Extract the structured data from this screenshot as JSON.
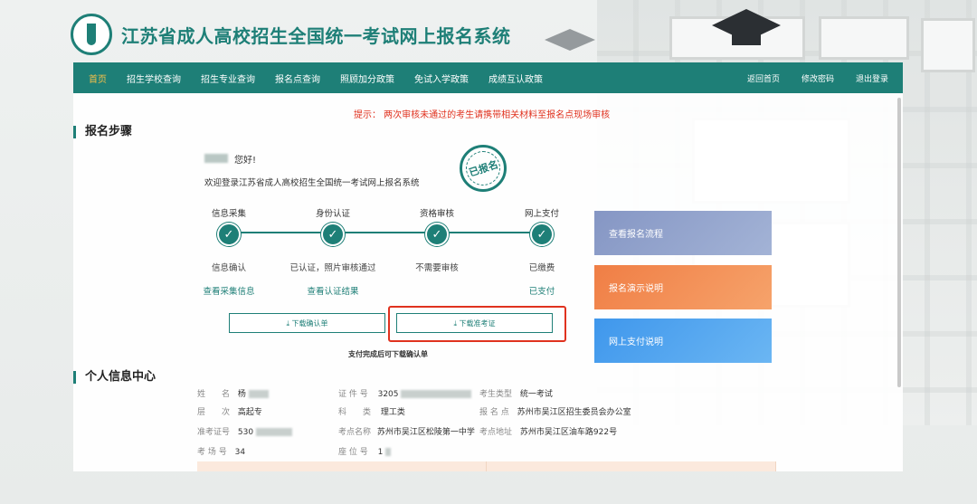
{
  "header": {
    "title": "江苏省成人高校招生全国统一考试网上报名系统"
  },
  "nav": {
    "items": [
      "首页",
      "招生学校查询",
      "招生专业查询",
      "报名点查询",
      "照顾加分政策",
      "免试入学政策",
      "成绩互认政策"
    ],
    "right_items": [
      "返回首页",
      "修改密码",
      "退出登录"
    ]
  },
  "hint": "提示：  两次审核未通过的考生请携带相关材料至报名点现场审核",
  "steps_section": {
    "title": "报名步骤",
    "greeting": "您好!",
    "welcome": "欢迎登录江苏省成人高校招生全国统一考试网上报名系统",
    "stamp": "已报名",
    "steps": [
      {
        "label": "信息采集",
        "status": "信息确认",
        "link": "查看采集信息"
      },
      {
        "label": "身份认证",
        "status": "已认证，照片审核通过",
        "link": "查看认证结果"
      },
      {
        "label": "资格审核",
        "status": "不需要审核",
        "link": ""
      },
      {
        "label": "网上支付",
        "status": "已缴费",
        "link": "已支付"
      }
    ],
    "download_confirm": "⤓ 下载确认单",
    "download_admission": "⤓ 下载准考证",
    "pay_note": "支付完成后可下载确认单"
  },
  "side_cards": [
    "查看报名流程",
    "报名演示说明",
    "网上支付说明"
  ],
  "info_section": {
    "title": "个人信息中心",
    "fields": {
      "name_label": "姓　　名",
      "name_value": "杨",
      "id_label": "证 件 号",
      "id_value": "3205",
      "type_label": "考生类型",
      "type_value": "统一考试",
      "level_label": "层　　次",
      "level_value": "高起专",
      "subject_label": "科　　类",
      "subject_value": "理工类",
      "site_label": "报 名 点",
      "site_value": "苏州市吴江区招生委员会办公室",
      "ticket_label": "准考证号",
      "ticket_value": "530",
      "exam_point_label": "考点名称",
      "exam_point_value": "苏州市吴江区松陵第一中学",
      "exam_addr_label": "考点地址",
      "exam_addr_value": "苏州市吴江区油车路922号",
      "room_label": "考 场 号",
      "room_value": "34",
      "seat_label": "座 位 号",
      "seat_value": "1"
    }
  },
  "colors": {
    "primary": "#1e7f77",
    "hint_red": "#e0321f",
    "card_blue_gray": "#8d9fc9",
    "card_orange": "#f28a4f",
    "card_blue": "#4ea3ef"
  }
}
